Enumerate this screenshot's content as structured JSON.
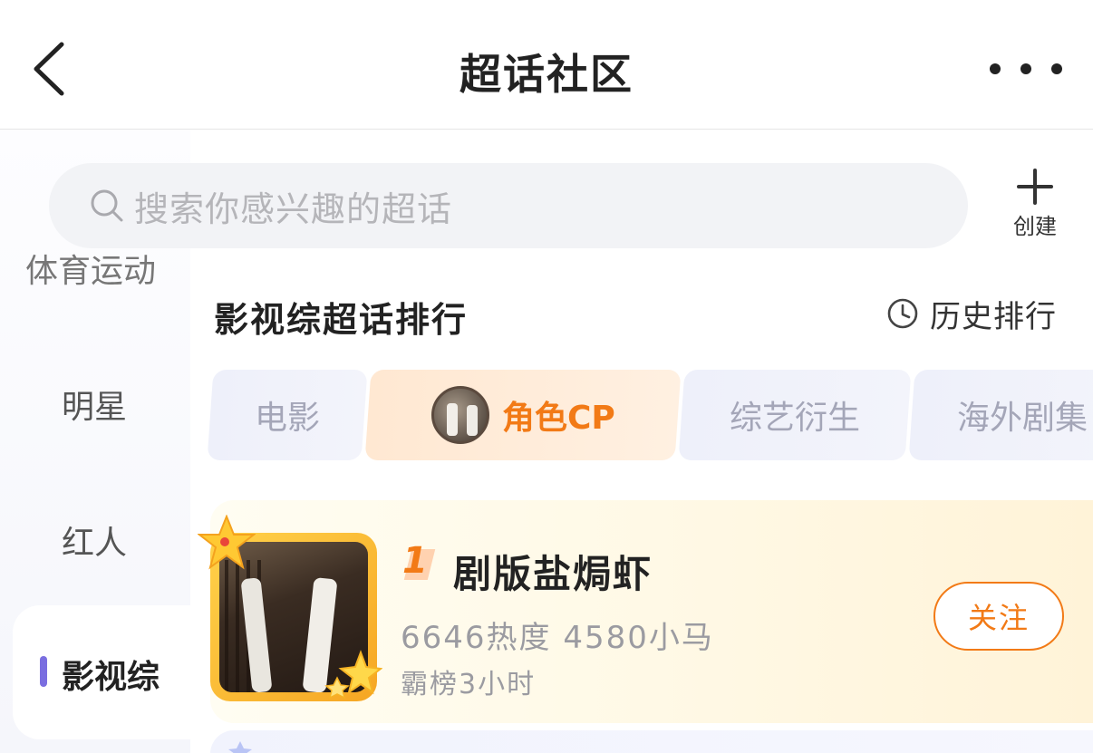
{
  "header": {
    "title": "超话社区",
    "back_icon": "chevron-left-icon",
    "more_icon": "more-dots-icon"
  },
  "search": {
    "placeholder": "搜索你感兴趣的超话",
    "icon": "search-icon"
  },
  "create": {
    "label": "创建",
    "icon": "plus-icon"
  },
  "sidebar": {
    "items": [
      {
        "label": "体育运动",
        "active": false
      },
      {
        "label": "明星",
        "active": false
      },
      {
        "label": "红人",
        "active": false
      },
      {
        "label": "影视综",
        "active": true
      }
    ],
    "active_color": "#7a6ee0"
  },
  "section": {
    "title": "影视综超话排行",
    "history_label": "历史排行",
    "history_icon": "clock-icon"
  },
  "tabs": [
    {
      "label": "电影",
      "selected": false
    },
    {
      "label": "角色CP",
      "selected": true
    },
    {
      "label": "综艺衍生",
      "selected": false
    },
    {
      "label": "海外剧集",
      "selected": false
    }
  ],
  "ranking": [
    {
      "rank": "1",
      "name": "剧版盐焗虾",
      "stats": "6646热度 4580小马",
      "bang": "霸榜3小时",
      "follow_label": "关注"
    }
  ],
  "colors": {
    "accent": "#f27a16",
    "text": "#222222",
    "muted": "#9b9ba1"
  }
}
